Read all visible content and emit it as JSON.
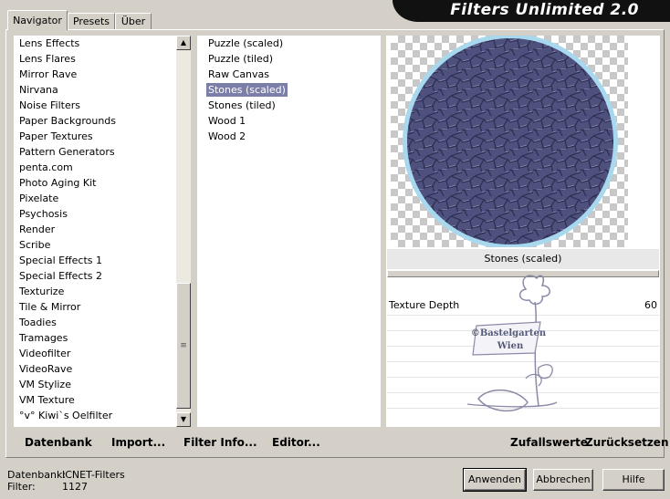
{
  "tabs": [
    {
      "label": "Navigator"
    },
    {
      "label": "Presets"
    },
    {
      "label": "Über"
    }
  ],
  "app_title": "Filters Unlimited 2.0",
  "categories": [
    "Lens Effects",
    "Lens Flares",
    "Mirror Rave",
    "Nirvana",
    "Noise Filters",
    "Paper Backgrounds",
    "Paper Textures",
    "Pattern Generators",
    "penta.com",
    "Photo Aging Kit",
    "Pixelate",
    "Psychosis",
    "Render",
    "Scribe",
    "Special Effects 1",
    "Special Effects 2",
    "Texturize",
    "Tile & Mirror",
    "Toadies",
    "Tramages",
    "Videofilter",
    "VideoRave",
    "VM Stylize",
    "VM Texture",
    "°v° Kiwi`s Oelfilter"
  ],
  "filters": [
    "Puzzle (scaled)",
    "Puzzle (tiled)",
    "Raw Canvas",
    "Stones (scaled)",
    "Stones (tiled)",
    "Wood 1",
    "Wood 2"
  ],
  "selected_filter_index": 3,
  "preview": {
    "filter_name": "Stones (scaled)",
    "stone_color": "#4e507e",
    "ring_color": "#a8d8ee"
  },
  "parameters": [
    {
      "label": "Texture Depth",
      "value": "60"
    }
  ],
  "watermark": {
    "line1": "©Bastelgarten",
    "line2": "Wien"
  },
  "left_actions": {
    "database": "Datenbank",
    "import": "Import...",
    "filter_info": "Filter Info...",
    "editor": "Editor..."
  },
  "right_actions": {
    "randomize": "Zufallswerte",
    "reset": "Zurücksetzen"
  },
  "status": {
    "db_label": "Datenbank:",
    "db_value": "ICNET-Filters",
    "filter_label": "Filter:",
    "filter_value": "1127"
  },
  "buttons": {
    "apply": "Anwenden",
    "cancel": "Abbrechen",
    "help": "Hilfe"
  },
  "scrollbar": {
    "up_icon": "▲",
    "down_icon": "▼",
    "grip_icon": "≡"
  }
}
